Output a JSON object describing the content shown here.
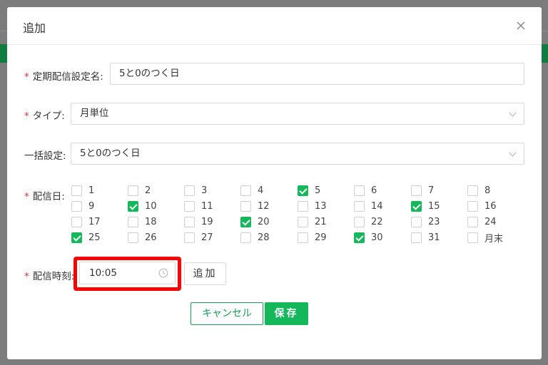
{
  "dialog": {
    "title": "追加"
  },
  "form": {
    "name": {
      "label": "定期配信設定名:",
      "value": "5と0のつく日"
    },
    "type": {
      "label": "タイプ:",
      "value": "月単位"
    },
    "bulk": {
      "label": "一括設定:",
      "value": "5と0のつく日"
    },
    "days": {
      "label": "配信日:",
      "options": [
        {
          "label": "1",
          "checked": false
        },
        {
          "label": "2",
          "checked": false
        },
        {
          "label": "3",
          "checked": false
        },
        {
          "label": "4",
          "checked": false
        },
        {
          "label": "5",
          "checked": true
        },
        {
          "label": "6",
          "checked": false
        },
        {
          "label": "7",
          "checked": false
        },
        {
          "label": "8",
          "checked": false
        },
        {
          "label": "9",
          "checked": false
        },
        {
          "label": "10",
          "checked": true
        },
        {
          "label": "11",
          "checked": false
        },
        {
          "label": "12",
          "checked": false
        },
        {
          "label": "13",
          "checked": false
        },
        {
          "label": "14",
          "checked": false
        },
        {
          "label": "15",
          "checked": true
        },
        {
          "label": "16",
          "checked": false
        },
        {
          "label": "17",
          "checked": false
        },
        {
          "label": "18",
          "checked": false
        },
        {
          "label": "19",
          "checked": false
        },
        {
          "label": "20",
          "checked": true
        },
        {
          "label": "21",
          "checked": false
        },
        {
          "label": "22",
          "checked": false
        },
        {
          "label": "23",
          "checked": false
        },
        {
          "label": "24",
          "checked": false
        },
        {
          "label": "25",
          "checked": true
        },
        {
          "label": "26",
          "checked": false
        },
        {
          "label": "27",
          "checked": false
        },
        {
          "label": "28",
          "checked": false
        },
        {
          "label": "29",
          "checked": false
        },
        {
          "label": "30",
          "checked": true
        },
        {
          "label": "31",
          "checked": false
        },
        {
          "label": "月末",
          "checked": false
        }
      ]
    },
    "time": {
      "label": "配信時刻:",
      "value": "10:05",
      "add_label": "追加"
    }
  },
  "footer": {
    "cancel_label": "キャンセル",
    "save_label": "保存"
  },
  "colors": {
    "accent": "#14b85a",
    "required": "#e63232",
    "highlight": "#ff0000"
  },
  "icons": {
    "close": "close-icon",
    "chevron": "chevron-down-icon",
    "clock": "clock-icon",
    "check": "check-icon"
  }
}
